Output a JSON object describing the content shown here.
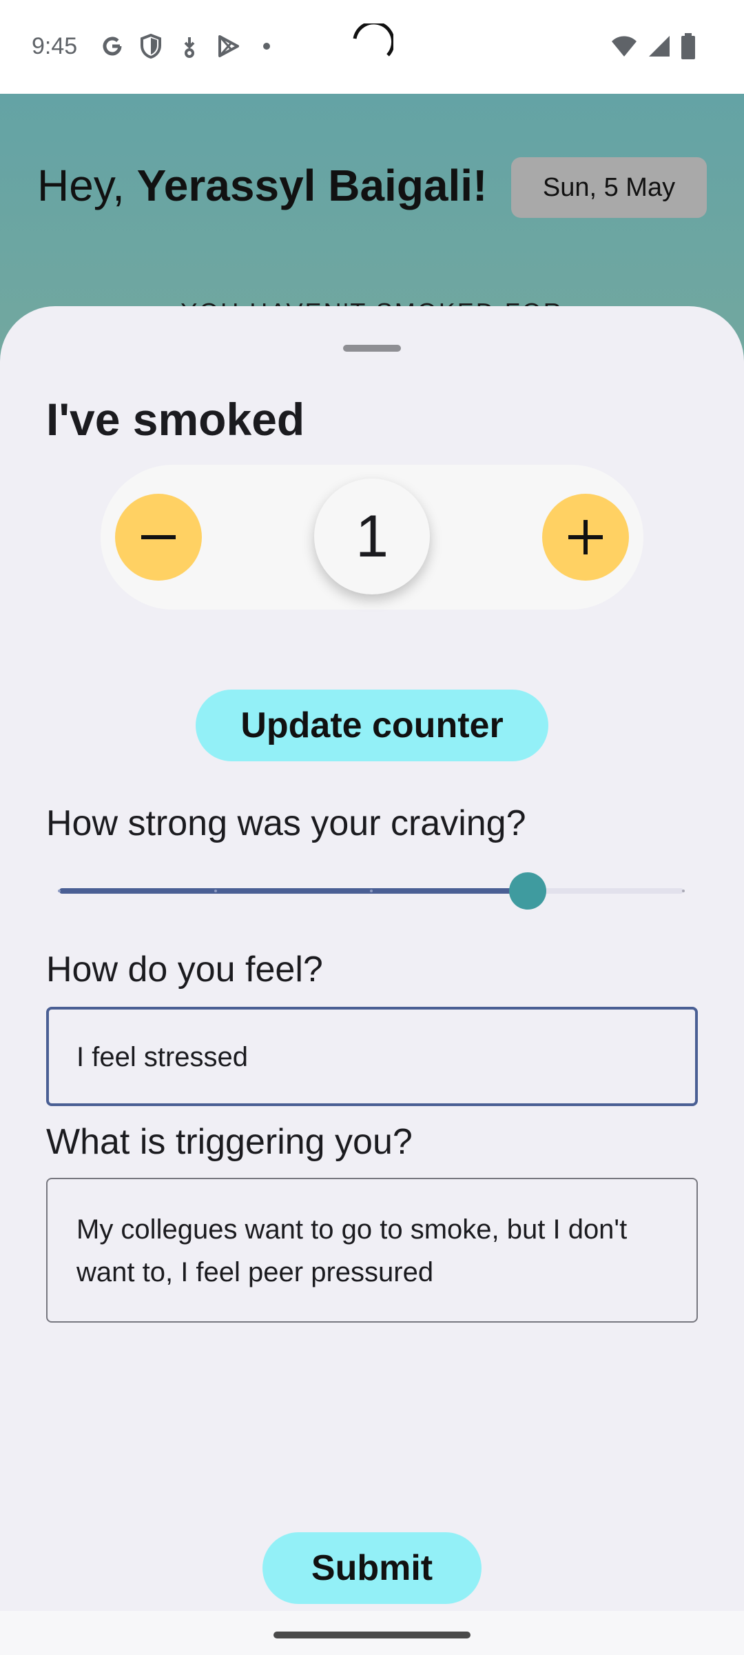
{
  "status_bar": {
    "time": "9:45",
    "left_icons": [
      "google-icon",
      "shield-icon",
      "download-icon",
      "play-store-icon",
      "dot-icon"
    ],
    "right_icons": [
      "wifi-icon",
      "signal-icon",
      "battery-icon"
    ]
  },
  "header": {
    "greeting_prefix": "Hey, ",
    "user_name": "Yerassyl Baigali!",
    "date": "Sun, 5 May",
    "peek_text": "YOU HAVEN'T SMOKED FOR"
  },
  "sheet": {
    "title": "I've smoked",
    "counter": {
      "value": "1",
      "minus_label": "−",
      "plus_label": "+"
    },
    "update_button": "Update counter",
    "craving": {
      "label": "How strong was your craving?",
      "slider_fraction": 0.75,
      "steps": 4
    },
    "feel": {
      "label": "How do you feel?",
      "value": "I feel stressed"
    },
    "trigger": {
      "label": "What is triggering you?",
      "value": "My collegues want to go to smoke, but I don't want to, I feel peer pressured"
    },
    "submit_button": "Submit"
  },
  "colors": {
    "header_bg": "#64a3a5",
    "accent_yellow": "#ffd163",
    "accent_cyan": "#93f0f7",
    "slider_active": "#4a5f94",
    "slider_thumb": "#3f9b9f",
    "sheet_bg": "#f0eff5"
  }
}
